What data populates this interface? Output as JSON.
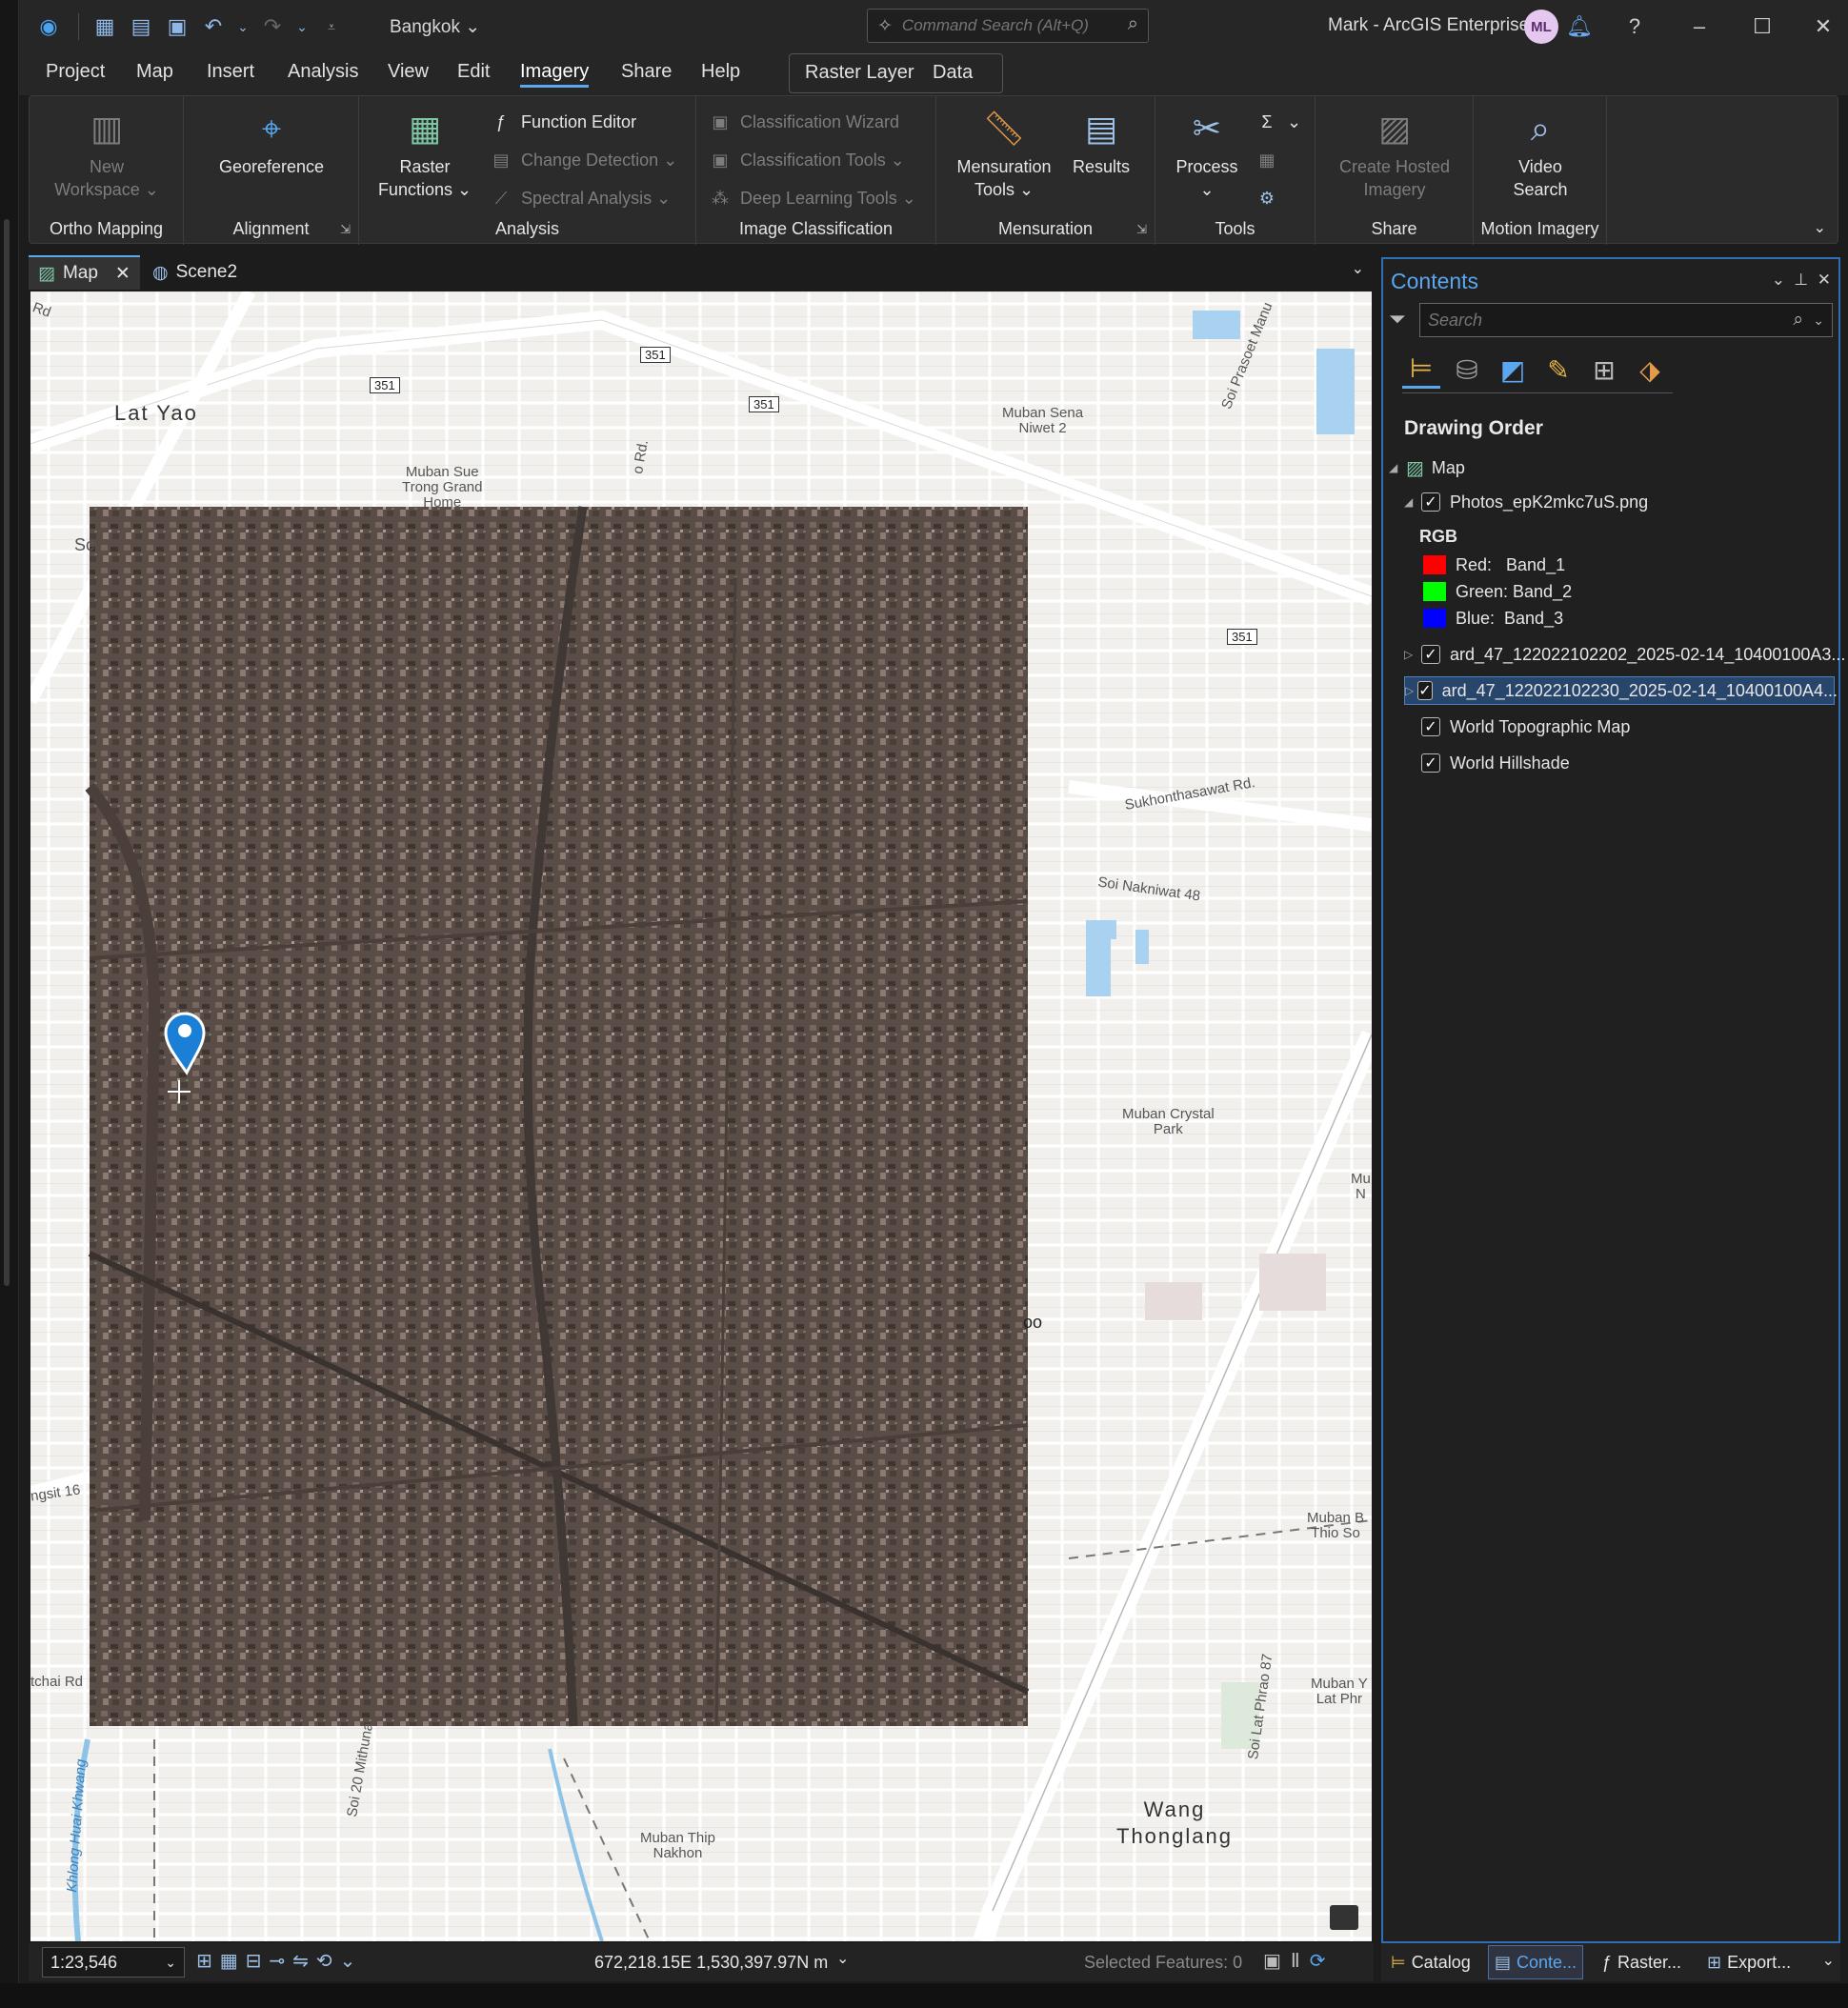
{
  "title_bar": {
    "project": "Bangkok",
    "command_search_placeholder": "Command Search (Alt+Q)",
    "user": "Mark - ArcGIS Enterprise",
    "avatar_initials": "ML"
  },
  "menu": {
    "tabs": [
      "Project",
      "Map",
      "Insert",
      "Analysis",
      "View",
      "Edit",
      "Imagery",
      "Share",
      "Help"
    ],
    "active": "Imagery",
    "contextual_tabs": [
      "Raster Layer",
      "Data"
    ]
  },
  "ribbon": {
    "ortho_mapping": {
      "label": "Ortho Mapping",
      "new_workspace": "New\nWorkspace ⌄"
    },
    "alignment": {
      "label": "Alignment",
      "georeference": "Georeference"
    },
    "analysis": {
      "label": "Analysis",
      "raster_functions": "Raster\nFunctions ⌄",
      "function_editor": "Function Editor",
      "change_detection": "Change Detection ⌄",
      "spectral_analysis": "Spectral Analysis ⌄"
    },
    "image_classification": {
      "label": "Image Classification",
      "classification_wizard": "Classification Wizard",
      "classification_tools": "Classification Tools ⌄",
      "deep_learning_tools": "Deep Learning Tools ⌄"
    },
    "mensuration": {
      "label": "Mensuration",
      "mensuration_tools": "Mensuration\nTools ⌄",
      "results": "Results"
    },
    "tools": {
      "label": "Tools",
      "process": "Process\n⌄"
    },
    "share": {
      "label": "Share",
      "create_hosted_imagery": "Create Hosted\nImagery"
    },
    "motion_imagery": {
      "label": "Motion Imagery",
      "video_search": "Video\nSearch"
    }
  },
  "view_tabs": [
    "Map",
    "Scene2"
  ],
  "map": {
    "labels": {
      "lat_yao": "Lat Yao",
      "muban_sue": "Muban Sue\nTrong Grand\nHome",
      "muban_sena": "Muban Sena\nNiwet 2",
      "sukhonthasawat": "Sukhonthasawat Rd.",
      "soi_nakniwat": "Soi Nakniwat 48",
      "muban_crystal": "Muban Crystal\nPark",
      "wang_thonglang": "Wang\nThonglang",
      "muban_thip": "Muban Thip\nNakhon",
      "soi_20_mithuna": "Soi 20 Mithuna",
      "khlong_huai_khwang": "Khlong Huai Khwang",
      "soi_lat_phrao_87": "Soi Lat Phrao 87",
      "muban_b": "Muban B\nThio So",
      "muban_y": "Muban Y\nLat Phr",
      "ngsit_16": "ngsit 16",
      "tchai_rd": "tchai Rd",
      "soi_prasoet": "Soi Prasoet Manu",
      "rd_corner": "Rd",
      "sc": "Sc",
      "mu_n": "Mu\nN",
      "o_rd": "o Rd.",
      "oo": "oo"
    },
    "shields": [
      "351",
      "351",
      "351",
      "351"
    ]
  },
  "status_bar": {
    "scale": "1:23,546",
    "coordinates": "672,218.15E 1,530,397.97N m",
    "selected_features": "Selected Features: 0"
  },
  "contents": {
    "title": "Contents",
    "search_placeholder": "Search",
    "drawing_order": "Drawing Order",
    "map_name": "Map",
    "layers": [
      {
        "name": "Photos_epK2mkc7uS.png",
        "checked": true
      },
      {
        "name": "ard_47_122022102202_2025-02-14_10400100A3...",
        "checked": true
      },
      {
        "name": "ard_47_122022102230_2025-02-14_10400100A4...",
        "checked": true,
        "selected": true
      },
      {
        "name": "World Topographic Map",
        "checked": true
      },
      {
        "name": "World Hillshade",
        "checked": true
      }
    ],
    "rgb": {
      "heading": "RGB",
      "red": "Red:   Band_1",
      "green": "Green: Band_2",
      "blue": "Blue:  Band_3",
      "colors": {
        "red": "#ff0000",
        "green": "#00ff00",
        "blue": "#0000ff"
      }
    }
  },
  "pane_tabs": [
    "Catalog",
    "Conte...",
    "Raster...",
    "Export..."
  ],
  "colors": {
    "accent": "#5aa7ef",
    "selected_row": "#28466b"
  }
}
